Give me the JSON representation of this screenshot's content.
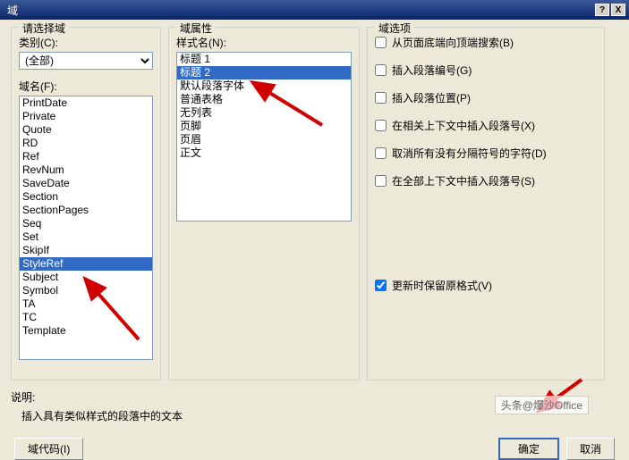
{
  "titlebar": {
    "title": "域",
    "help": "?",
    "close": "X"
  },
  "col1": {
    "group_title": "请选择域",
    "category_label": "类别(C):",
    "category_selected": "(全部)",
    "fieldname_label": "域名(F):",
    "fields": [
      "PrintDate",
      "Private",
      "Quote",
      "RD",
      "Ref",
      "RevNum",
      "SaveDate",
      "Section",
      "SectionPages",
      "Seq",
      "Set",
      "SkipIf",
      "StyleRef",
      "Subject",
      "Symbol",
      "TA",
      "TC",
      "Template"
    ],
    "fields_selected_index": 12
  },
  "col2": {
    "group_title": "域属性",
    "stylename_label": "样式名(N):",
    "styles": [
      "标题 1",
      "标题 2",
      "默认段落字体",
      "普通表格",
      "无列表",
      "页脚",
      "页眉",
      "正文"
    ],
    "styles_selected_index": 1
  },
  "col3": {
    "group_title": "域选项",
    "options": [
      "从页面底端向顶端搜索(B)",
      "插入段落编号(G)",
      "插入段落位置(P)",
      "在相关上下文中插入段落号(X)",
      "取消所有没有分隔符号的字符(D)",
      "在全部上下文中插入段落号(S)"
    ],
    "preserve_label": "更新时保留原格式(V)"
  },
  "desc": {
    "label": "说明:",
    "text": "插入具有类似样式的段落中的文本"
  },
  "buttons": {
    "fieldcodes": "域代码(I)",
    "ok": "确定",
    "cancel": "取消"
  },
  "watermark": "头条@爆沙Office"
}
